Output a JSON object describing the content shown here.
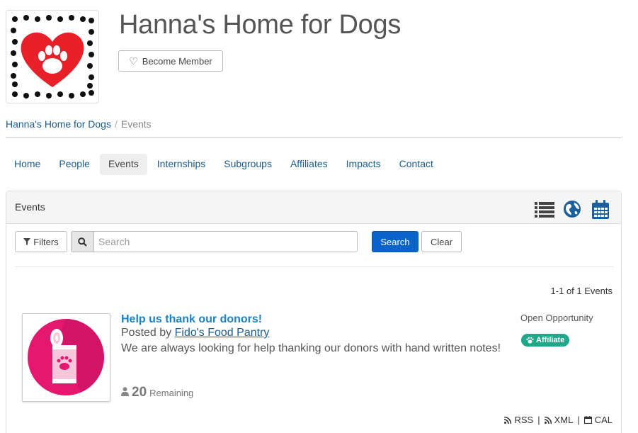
{
  "org": {
    "name": "Hanna's Home for Dogs",
    "become_member_label": "Become Member"
  },
  "breadcrumb": {
    "home": "Hanna's Home for Dogs",
    "separator": "/",
    "current": "Events"
  },
  "nav": {
    "items": [
      {
        "label": "Home",
        "active": false
      },
      {
        "label": "People",
        "active": false
      },
      {
        "label": "Events",
        "active": true
      },
      {
        "label": "Internships",
        "active": false
      },
      {
        "label": "Subgroups",
        "active": false
      },
      {
        "label": "Affiliates",
        "active": false
      },
      {
        "label": "Impacts",
        "active": false
      },
      {
        "label": "Contact",
        "active": false
      }
    ]
  },
  "panel": {
    "title": "Events",
    "view_icons": [
      "list-view-icon",
      "globe-icon",
      "calendar-icon"
    ]
  },
  "filters": {
    "filters_label": "Filters",
    "search_placeholder": "Search",
    "search_value": "",
    "search_button": "Search",
    "clear_button": "Clear"
  },
  "results": {
    "count_text": "1-1 of 1 Events"
  },
  "event": {
    "title": "Help us thank our donors!",
    "posted_prefix": "Posted by",
    "posted_by": "Fido's Food Pantry",
    "description": "We are always looking for help thanking our donors with hand written notes!",
    "remaining_count": "20",
    "remaining_label": "Remaining",
    "opportunity": "Open Opportunity",
    "badge": "Affiliate"
  },
  "feeds": {
    "rss": "RSS",
    "xml": "XML",
    "cal": "CAL"
  },
  "colors": {
    "link": "#1a5d8f",
    "event_title": "#1a82c4",
    "primary_button": "#0a63c9",
    "badge": "#1fa789",
    "heart": "#e8202a",
    "event_icon_circle": "#e5176e",
    "view_icon": "#1b5f9c"
  }
}
